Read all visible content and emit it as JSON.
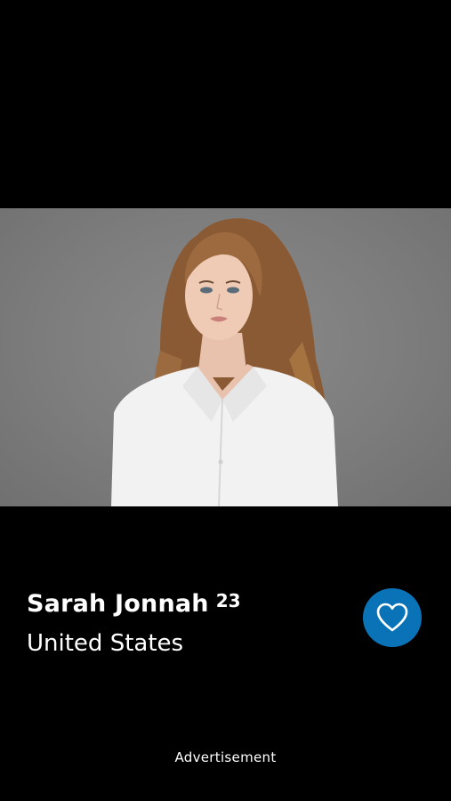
{
  "photo": {
    "icon": "profile-photo",
    "background_color": "#7d7d7d"
  },
  "profile": {
    "name": "Sarah Jonnah",
    "age": "23",
    "location": "United States"
  },
  "like_button": {
    "icon": "heart-icon",
    "color": "#0a73b8"
  },
  "footer": {
    "ad_label": "Advertisement"
  }
}
